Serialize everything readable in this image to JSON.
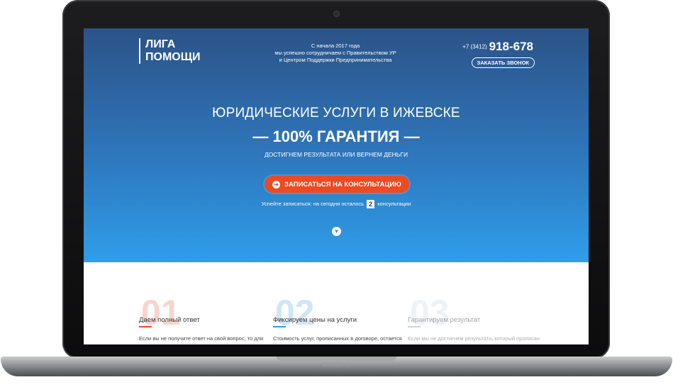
{
  "device": {
    "brand_label": "MacBook"
  },
  "header": {
    "logo_line1": "ЛИГА",
    "logo_line2": "ПОМОЩИ",
    "tagline": [
      "С начала 2017 года",
      "мы успешно сотрудничаем с Правительством УР",
      "и Центром Поддержки Предпринимательства"
    ],
    "phone_code": "+7 (3412)",
    "phone_number": "918-678",
    "call_button_label": "ЗАКАЗАТЬ ЗВОНОК"
  },
  "hero": {
    "heading": "ЮРИДИЧЕСКИЕ УСЛУГИ В ИЖЕВСКЕ",
    "guarantee": "— 100% ГАРАНТИЯ —",
    "subheading": "ДОСТИГНЕМ РЕЗУЛЬТАТА ИЛИ ВЕРНЕМ ДЕНЬГИ",
    "cta_label": "ЗАПИСАТЬСЯ НА КОНСУЛЬТАЦИЮ",
    "hurry_prefix": "Успейте записаться: на сегодня осталось",
    "hurry_count": "2",
    "hurry_suffix": "консультации"
  },
  "features": [
    {
      "number": "01",
      "title": "Даем полный ответ",
      "desc": "Если вы не получите ответ на свой вопрос, то для"
    },
    {
      "number": "02",
      "title": "Фиксируем цены на услуги",
      "desc": "Стоимость услуг, прописанных в договоре, остается"
    },
    {
      "number": "03",
      "title": "Гарантируем результат",
      "desc": "Если мы не достигнем результата, который прописан"
    }
  ],
  "colors": {
    "accent": "#ec4a22",
    "hero_top": "#2c5387",
    "hero_bottom": "#2f9ee9"
  },
  "icons": {
    "cta": "arrow-right-circle-icon",
    "scroll": "arrow-down-circle-icon"
  }
}
